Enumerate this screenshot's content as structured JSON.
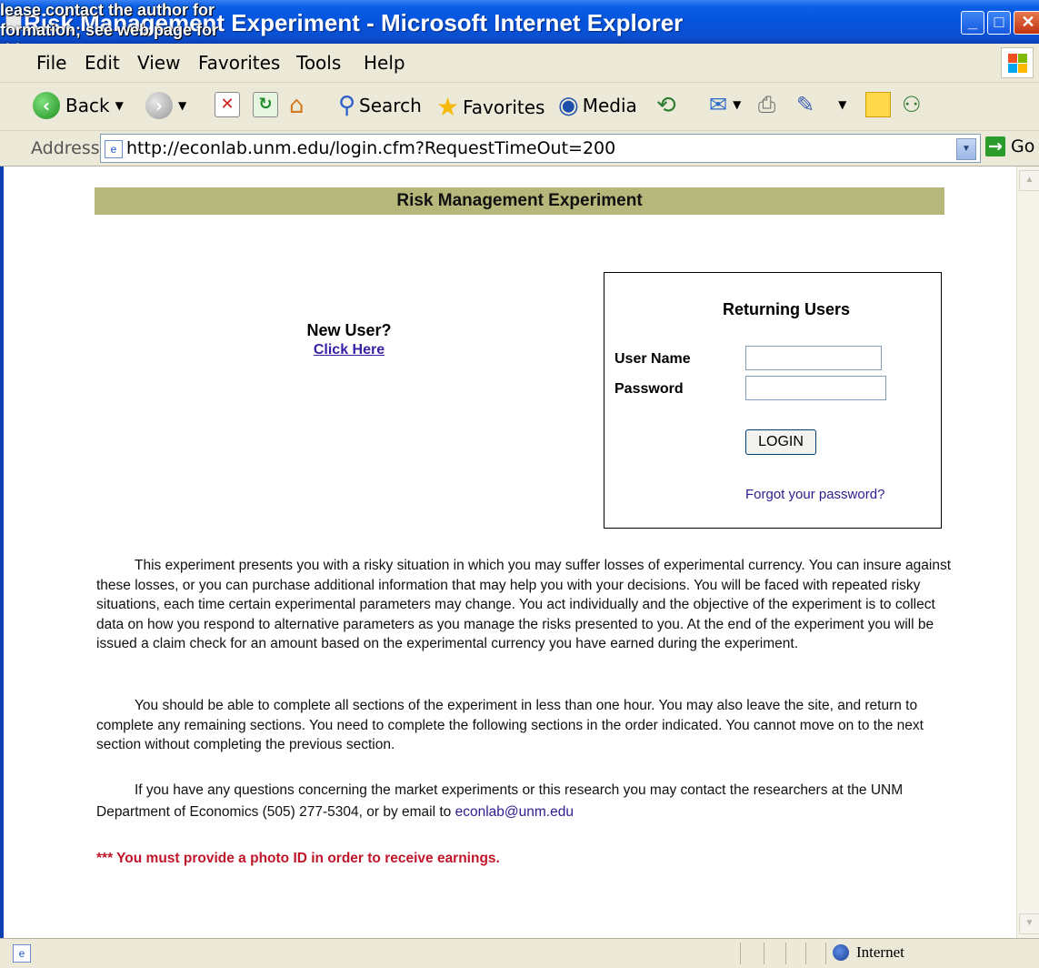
{
  "window": {
    "title": "Risk Management Experiment - Microsoft Internet Explorer",
    "overlay_note": "lease contact the author for formation; see web page for ddress."
  },
  "menu": [
    "File",
    "Edit",
    "View",
    "Favorites",
    "Tools",
    "Help"
  ],
  "toolbar": {
    "back_label": "Back",
    "search_label": "Search",
    "favorites_label": "Favorites",
    "media_label": "Media"
  },
  "address": {
    "label": "Address",
    "url": "http://econlab.unm.edu/login.cfm?RequestTimeOut=200",
    "go_label": "Go"
  },
  "page": {
    "header": "Risk Management Experiment",
    "new_user": {
      "label": "New User?",
      "link": "Click Here"
    },
    "login": {
      "title": "Returning Users",
      "username_label": "User Name",
      "password_label": "Password",
      "username_value": "",
      "password_value": "",
      "button": "LOGIN",
      "forgot": "Forgot your password?"
    },
    "paragraph1": "This experiment presents you with a risky situation in which you may suffer losses of experimental currency. You can insure against these losses, or you can purchase additional information that may help you with your decisions. You will be faced with repeated risky situations, each time certain experimental parameters may change. You act individually and the objective of the experiment is to collect data on how you respond to alternative parameters as you manage the risks presented to you. At the end of the experiment you will be issued a claim check for an amount based on the experimental currency you have earned during the experiment.",
    "paragraph2": "You should be able to complete all sections of the experiment in less than one hour. You may also leave the site, and return to complete any remaining sections. You need to complete the following sections in the order indicated. You cannot move on to the next section without completing the previous section.",
    "paragraph3_text": "If you have any questions concerning the market experiments or this research you may contact the researchers at the UNM Department of Economics (505) 277-5304, or by email to",
    "email": "econlab@unm.edu",
    "warning": "*** You must provide a photo ID in order to receive earnings."
  },
  "status": {
    "zone": "Internet"
  }
}
